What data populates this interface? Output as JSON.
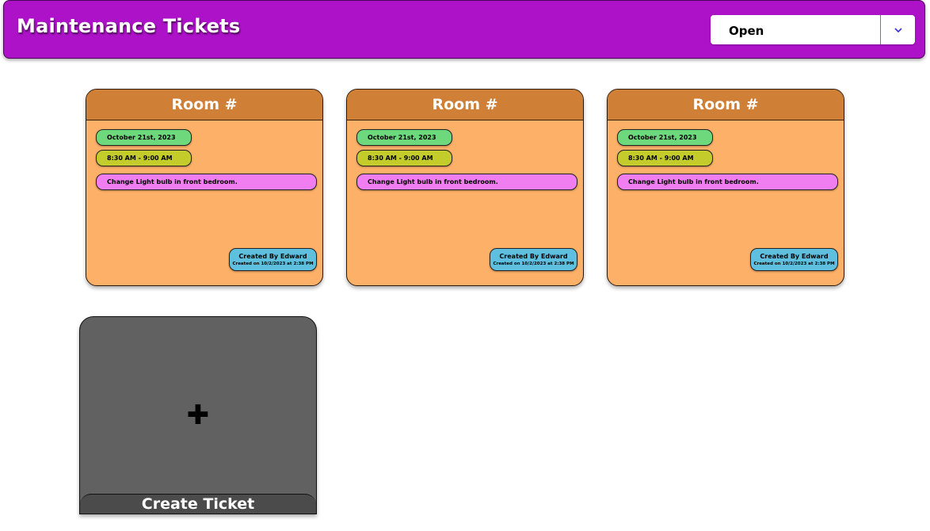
{
  "header": {
    "title": "Maintenance Tickets",
    "status_filter": {
      "selected": "Open"
    }
  },
  "tickets": [
    {
      "room": "Room #",
      "date": "October 21st, 2023",
      "time": "8:30 AM - 9:00 AM",
      "description": "Change Light bulb in front bedroom.",
      "created_by": "Created By Edward",
      "created_on": "Created on 10/2/2023 at 2:38 PM"
    },
    {
      "room": "Room #",
      "date": "October 21st, 2023",
      "time": "8:30 AM - 9:00 AM",
      "description": "Change Light bulb in front bedroom.",
      "created_by": "Created By Edward",
      "created_on": "Created on 10/2/2023 at 2:38 PM"
    },
    {
      "room": "Room #",
      "date": "October 21st, 2023",
      "time": "8:30 AM - 9:00 AM",
      "description": "Change Light bulb in front bedroom.",
      "created_by": "Created By Edward",
      "created_on": "Created on 10/2/2023 at 2:38 PM"
    }
  ],
  "create_ticket": {
    "icon": "plus-icon",
    "label": "Create Ticket"
  },
  "colors": {
    "header_bg": "#ad12c8",
    "card_bg": "#fdb068",
    "card_header": "#d07f36",
    "date_pill": "#6ed87c",
    "time_pill": "#c4cc2c",
    "description_pill": "#f07ef0",
    "creator_pill": "#5ec0de",
    "create_card_bg": "#616161"
  }
}
